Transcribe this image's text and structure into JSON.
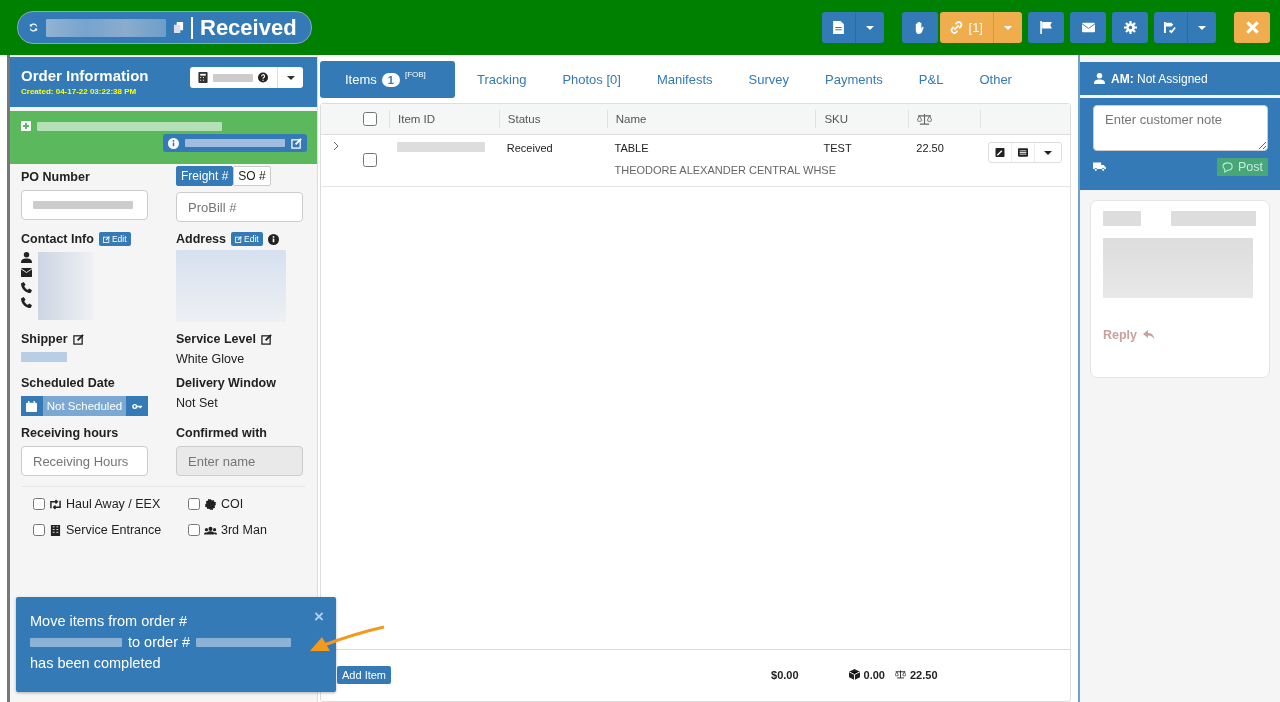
{
  "header": {
    "status": "Received"
  },
  "toolbar": [
    {
      "color": "#337ab7",
      "caret": true
    },
    {
      "color": "#337ab7",
      "caret": false
    },
    {
      "color": "#f0ad4e",
      "caret": true,
      "label": "[1]"
    },
    {
      "color": "#337ab7",
      "caret": false
    },
    {
      "color": "#337ab7",
      "caret": false
    },
    {
      "color": "#337ab7",
      "caret": false
    },
    {
      "color": "#337ab7",
      "caret": true
    },
    {
      "color": "#f0ad4e",
      "caret": false
    }
  ],
  "order_info": {
    "title": "Order Information",
    "created": "Created: 04-17-22 03:22:38 PM"
  },
  "po": {
    "label": "PO Number"
  },
  "number_type": [
    {
      "label": "Freight #",
      "selected": true
    },
    {
      "label": "SO #",
      "selected": false
    }
  ],
  "probill": {
    "placeholder": "ProBill #"
  },
  "contact": {
    "label": "Contact Info",
    "edit": "Edit"
  },
  "address": {
    "label": "Address",
    "edit": "Edit"
  },
  "shipper": {
    "label": "Shipper"
  },
  "service_level": {
    "label": "Service Level",
    "value": "White Glove"
  },
  "scheduled_date": {
    "label": "Scheduled Date",
    "value": "Not Scheduled"
  },
  "delivery_window": {
    "label": "Delivery Window",
    "value": "Not Set"
  },
  "receiving_hours": {
    "label": "Receiving hours",
    "placeholder": "Receiving Hours"
  },
  "confirmed_with": {
    "label": "Confirmed with",
    "placeholder": "Enter name",
    "disabled": true
  },
  "options": [
    {
      "label": "Haul Away / EEX",
      "checked": false
    },
    {
      "label": "COI",
      "checked": false
    },
    {
      "label": "Service Entrance",
      "checked": false
    },
    {
      "label": "3rd Man",
      "checked": false
    }
  ],
  "tabs": [
    {
      "label": "Items",
      "badge": "1",
      "note": "[FOB]",
      "selected": true
    },
    {
      "label": "Tracking",
      "selected": false
    },
    {
      "label": "Photos [0]",
      "selected": false
    },
    {
      "label": "Manifests",
      "selected": false
    },
    {
      "label": "Survey",
      "selected": false
    },
    {
      "label": "Payments",
      "selected": false
    },
    {
      "label": "P&L",
      "selected": false
    },
    {
      "label": "Other",
      "selected": false
    }
  ],
  "table": {
    "all_checked": false,
    "columns": [
      "Item ID",
      "Status",
      "Name",
      "SKU"
    ],
    "rows": [
      {
        "checked": false,
        "expanded": false,
        "status": "Received",
        "name": "TABLE",
        "location": "THEODORE ALEXANDER CENTRAL WHSE",
        "sku": "TEST",
        "weight": "22.50"
      }
    ]
  },
  "footer": {
    "add": "Add Item",
    "total": "$0.00",
    "volume": "0.00",
    "weight": "22.50"
  },
  "am": {
    "label": "AM:",
    "value": "Not Assigned"
  },
  "note": {
    "placeholder": "Enter customer note",
    "post": "Post"
  },
  "comment": {
    "reply": "Reply"
  },
  "toast": {
    "line_1": "Move items from order #",
    "line_2": "to order #",
    "line_3": "has been completed",
    "close": "×"
  }
}
